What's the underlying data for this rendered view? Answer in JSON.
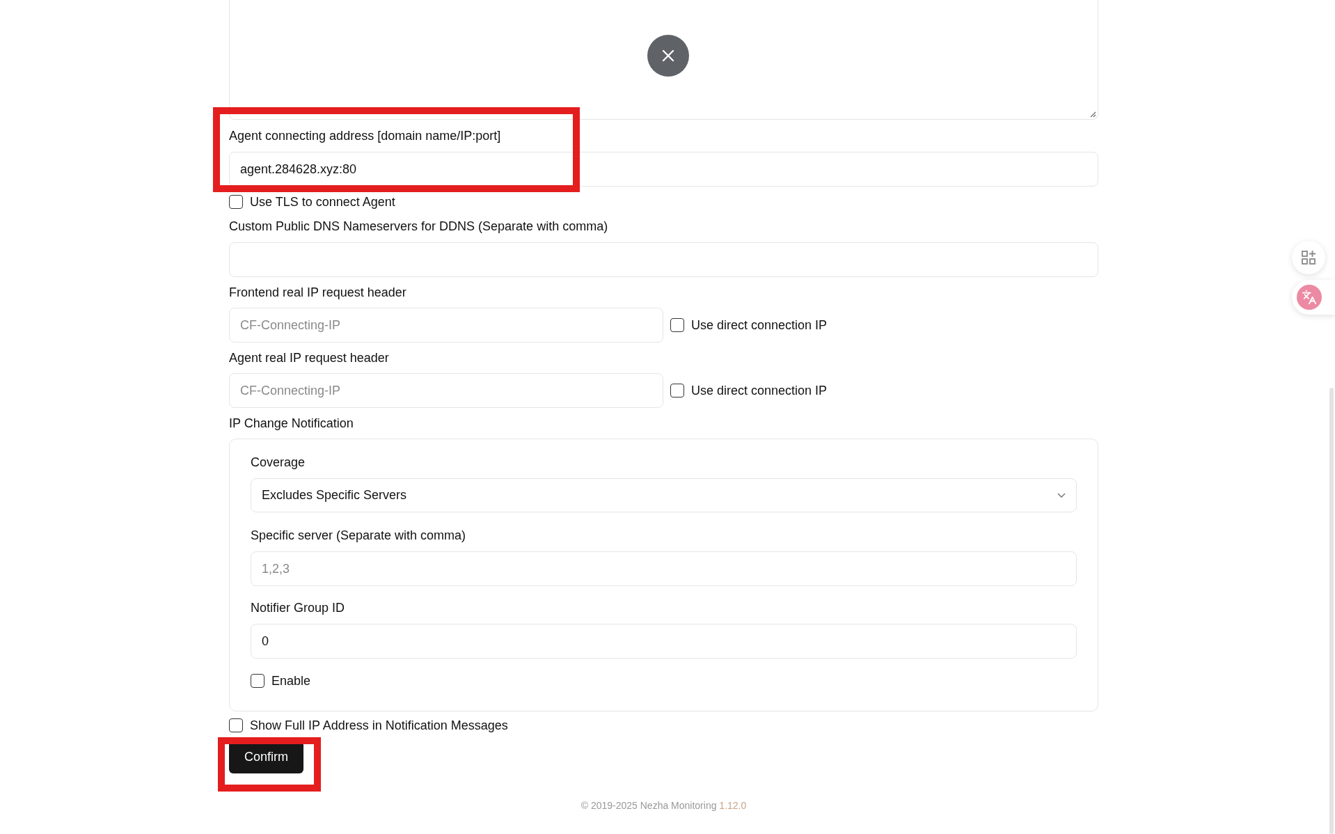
{
  "agent_address": {
    "label": "Agent connecting address [domain name/IP:port]",
    "value": "agent.284628.xyz:80"
  },
  "use_tls": {
    "label": "Use TLS to connect Agent",
    "checked": false
  },
  "dns_servers": {
    "label": "Custom Public DNS Nameservers for DDNS (Separate with comma)"
  },
  "frontend_ip_header": {
    "label": "Frontend real IP request header",
    "placeholder": "CF-Connecting-IP",
    "direct_label": "Use direct connection IP",
    "checked": false
  },
  "agent_ip_header": {
    "label": "Agent real IP request header",
    "placeholder": "CF-Connecting-IP",
    "direct_label": "Use direct connection IP",
    "checked": false
  },
  "ip_change_notification": {
    "label": "IP Change Notification",
    "coverage": {
      "label": "Coverage",
      "value": "Excludes Specific Servers"
    },
    "specific_server": {
      "label": "Specific server (Separate with comma)",
      "placeholder": "1,2,3"
    },
    "notifier_group": {
      "label": "Notifier Group ID",
      "value": "0"
    },
    "enable": {
      "label": "Enable",
      "checked": false
    }
  },
  "show_full_ip": {
    "label": "Show Full IP Address in Notification Messages",
    "checked": false
  },
  "confirm_button": "Confirm",
  "footer": {
    "text": "© 2019-2025 Nezha Monitoring",
    "version": "1.12.0"
  }
}
